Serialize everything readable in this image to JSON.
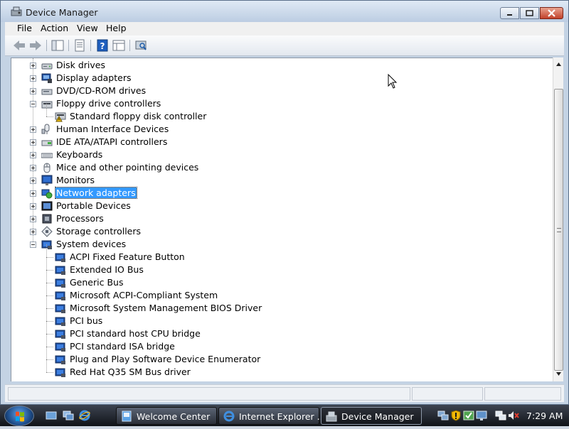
{
  "window": {
    "title": "Device Manager",
    "menu": [
      "File",
      "Action",
      "View",
      "Help"
    ],
    "toolbar_icons": [
      "back-icon",
      "forward-icon",
      "show-hide-tree-icon",
      "properties-icon",
      "help-icon",
      "view-icon",
      "scan-hardware-icon"
    ]
  },
  "tree": [
    {
      "label": "Disk drives",
      "icon": "disk-drive-icon",
      "level": 1,
      "expandable": true,
      "expanded": false
    },
    {
      "label": "Display adapters",
      "icon": "display-adapter-icon",
      "level": 1,
      "expandable": true,
      "expanded": false
    },
    {
      "label": "DVD/CD-ROM drives",
      "icon": "dvd-drive-icon",
      "level": 1,
      "expandable": true,
      "expanded": false
    },
    {
      "label": "Floppy drive controllers",
      "icon": "floppy-controller-icon",
      "level": 1,
      "expandable": true,
      "expanded": true
    },
    {
      "label": "Standard floppy disk controller",
      "icon": "floppy-controller-warning-icon",
      "level": 2,
      "expandable": false
    },
    {
      "label": "Human Interface Devices",
      "icon": "hid-icon",
      "level": 1,
      "expandable": true,
      "expanded": false
    },
    {
      "label": "IDE ATA/ATAPI controllers",
      "icon": "ide-controller-icon",
      "level": 1,
      "expandable": true,
      "expanded": false
    },
    {
      "label": "Keyboards",
      "icon": "keyboard-icon",
      "level": 1,
      "expandable": true,
      "expanded": false
    },
    {
      "label": "Mice and other pointing devices",
      "icon": "mouse-icon",
      "level": 1,
      "expandable": true,
      "expanded": false
    },
    {
      "label": "Monitors",
      "icon": "monitor-icon",
      "level": 1,
      "expandable": true,
      "expanded": false
    },
    {
      "label": "Network adapters",
      "icon": "network-adapter-icon",
      "level": 1,
      "expandable": true,
      "expanded": false,
      "selected": true
    },
    {
      "label": "Portable Devices",
      "icon": "portable-device-icon",
      "level": 1,
      "expandable": true,
      "expanded": false
    },
    {
      "label": "Processors",
      "icon": "processor-icon",
      "level": 1,
      "expandable": true,
      "expanded": false
    },
    {
      "label": "Storage controllers",
      "icon": "storage-controller-icon",
      "level": 1,
      "expandable": true,
      "expanded": false
    },
    {
      "label": "System devices",
      "icon": "system-device-icon",
      "level": 1,
      "expandable": true,
      "expanded": true
    },
    {
      "label": "ACPI Fixed Feature Button",
      "icon": "system-device-icon",
      "level": 2,
      "expandable": false
    },
    {
      "label": "Extended IO Bus",
      "icon": "system-device-icon",
      "level": 2,
      "expandable": false
    },
    {
      "label": "Generic Bus",
      "icon": "system-device-icon",
      "level": 2,
      "expandable": false
    },
    {
      "label": "Microsoft ACPI-Compliant System",
      "icon": "system-device-icon",
      "level": 2,
      "expandable": false
    },
    {
      "label": "Microsoft System Management BIOS Driver",
      "icon": "system-device-icon",
      "level": 2,
      "expandable": false
    },
    {
      "label": "PCI bus",
      "icon": "system-device-icon",
      "level": 2,
      "expandable": false
    },
    {
      "label": "PCI standard host CPU bridge",
      "icon": "system-device-icon",
      "level": 2,
      "expandable": false
    },
    {
      "label": "PCI standard ISA bridge",
      "icon": "system-device-icon",
      "level": 2,
      "expandable": false
    },
    {
      "label": "Plug and Play Software Device Enumerator",
      "icon": "system-device-icon",
      "level": 2,
      "expandable": false
    },
    {
      "label": "Red Hat Q35 SM Bus driver",
      "icon": "system-device-icon",
      "level": 2,
      "expandable": false
    }
  ],
  "taskbar": {
    "quick_launch": [
      "show-desktop-icon",
      "switch-windows-icon",
      "internet-explorer-icon"
    ],
    "tasks": [
      {
        "label": "Welcome Center",
        "icon": "welcome-center-icon",
        "active": false
      },
      {
        "label": "Internet Explorer ...",
        "icon": "internet-explorer-icon",
        "active": false
      },
      {
        "label": "Device Manager",
        "icon": "device-manager-icon",
        "active": true
      }
    ],
    "tray_icons": [
      "network-tray-icon",
      "security-shield-icon",
      "windows-update-icon",
      "display-tray-icon",
      "network-disconnected-icon",
      "volume-muted-icon"
    ],
    "clock": "7:29 AM"
  },
  "colors": {
    "selection": "#3399ff",
    "window_frame": "#c4d3e4",
    "close_button": "#c2412a"
  }
}
